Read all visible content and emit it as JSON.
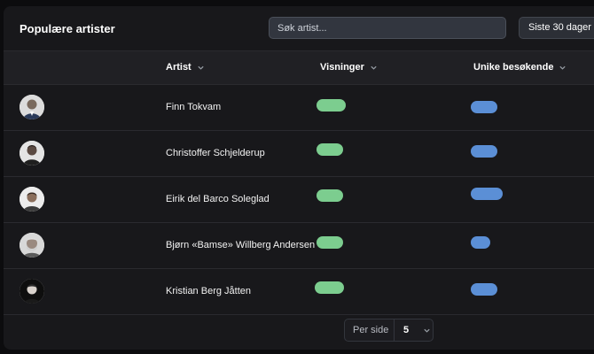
{
  "header": {
    "title": "Populære artister",
    "search_placeholder": "Søk artist...",
    "range_label": "Siste 30 dager"
  },
  "table": {
    "columns": [
      "Artist",
      "Visninger",
      "Unike besøkende"
    ],
    "rows": [
      {
        "name": "Finn Tokvam",
        "views": 0.6,
        "unique": 0.55
      },
      {
        "name": "Christoffer Schjelderup",
        "views": 0.55,
        "unique": 0.55
      },
      {
        "name": "Eirik del Barco Soleglad",
        "views": 0.55,
        "unique": 0.65
      },
      {
        "name": "Bjørn «Bamse» Willberg Andersen",
        "views": 0.55,
        "unique": 0.4
      },
      {
        "name": "Kristian Berg Jåtten",
        "views": 0.6,
        "unique": 0.55
      }
    ]
  },
  "pagination": {
    "label": "Per side",
    "value": "5"
  },
  "colors": {
    "views_bar": "#7ccd8f",
    "unique_bar": "#5b8fd6"
  }
}
